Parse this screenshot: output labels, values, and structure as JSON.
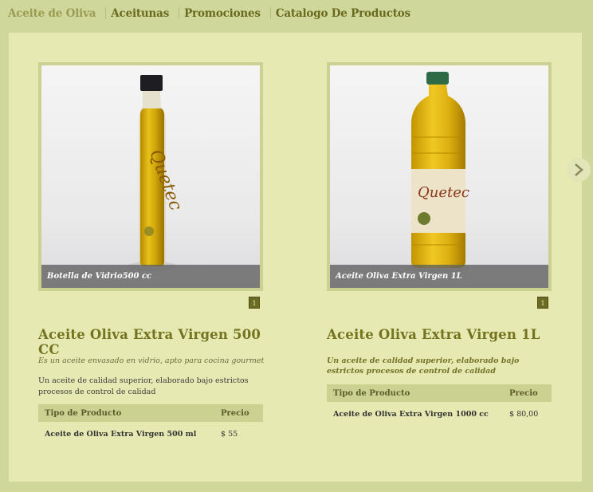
{
  "nav": {
    "items": [
      {
        "label": "Aceite de Oliva",
        "active": true
      },
      {
        "label": "Aceitunas"
      },
      {
        "label": "Promociones"
      },
      {
        "label": "Catalogo De Productos"
      }
    ]
  },
  "products": [
    {
      "image_caption": "Botella de Vidrio500 cc",
      "pager": "1",
      "title": "Aceite Oliva Extra Virgen 500 CC",
      "subtitle": "Es un aceite envasado en vidrio, apto para cocina gourmet",
      "description": "Un aceite de calidad superior, elaborado  bajo estrictos procesos de control de calidad",
      "table": {
        "headers": [
          "Tipo de Producto",
          "Precio"
        ],
        "rows": [
          [
            "Aceite de Oliva Extra Virgen 500 ml",
            "$ 55"
          ]
        ]
      }
    },
    {
      "image_caption": "Aceite Oliva Extra Virgen 1L",
      "pager": "1",
      "title": "Aceite Oliva Extra Virgen 1L",
      "subtitle": "Un aceite de calidad superior, elaborado  bajo estrictos procesos de control de calidad",
      "table": {
        "headers": [
          "Tipo de Producto",
          "Precio"
        ],
        "rows": [
          [
            "Aceite de Oliva Extra Virgen 1000 cc",
            "$ 80,00"
          ]
        ]
      }
    }
  ],
  "colors": {
    "background": "#cfd79a",
    "panel": "#e6eab2",
    "title": "#74731f",
    "nav_text": "#6a6a1f"
  }
}
